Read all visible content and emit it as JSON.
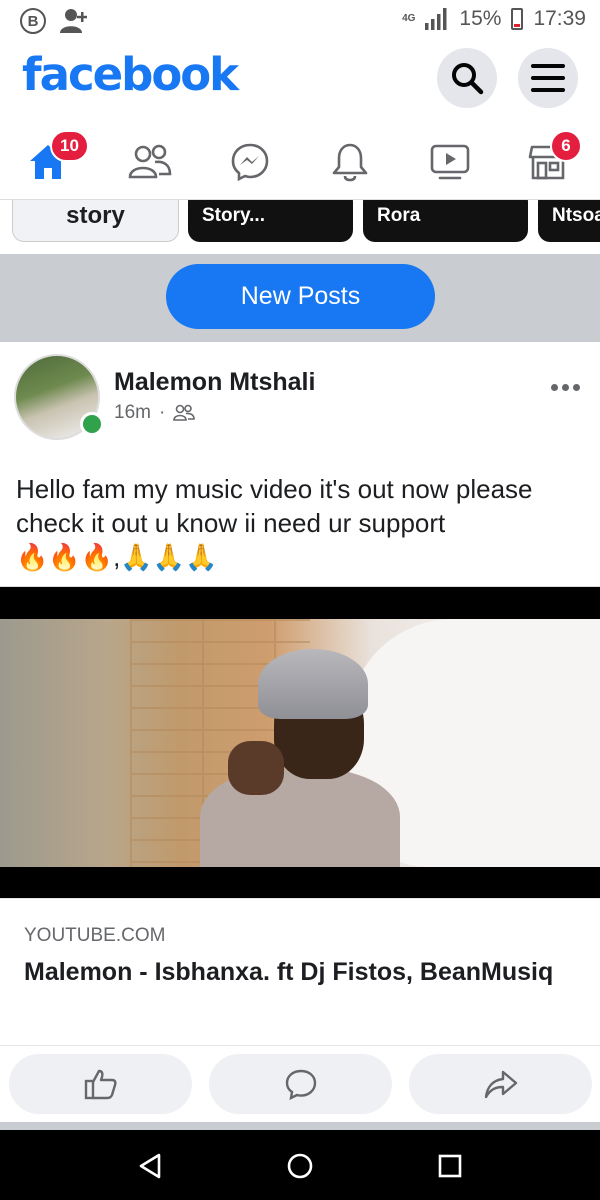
{
  "status_bar": {
    "network": "4G",
    "battery": "15%",
    "time": "17:39"
  },
  "header": {
    "logo": "facebook"
  },
  "nav": {
    "home_badge": "10",
    "marketplace_badge": "6"
  },
  "stories": [
    {
      "label": "story"
    },
    {
      "label": "Story..."
    },
    {
      "label": "Rora"
    },
    {
      "label": "Ntsoa"
    }
  ],
  "new_posts_label": "New Posts",
  "post": {
    "author": "Malemon Mtshali",
    "time": "16m",
    "separator": "·",
    "text_line1": "Hello fam my music video it's out now please",
    "text_line2": "check it out u know ii need ur support",
    "text_line3": "🔥🔥🔥,🙏🙏🙏",
    "link_domain": "YOUTUBE.COM",
    "link_title": "Malemon - Isbhanxa. ft Dj Fistos, BeanMusiq"
  },
  "icons": {
    "blackberry": "b-icon",
    "add_friend": "add-person-icon",
    "search": "search-icon",
    "menu": "menu-icon",
    "home": "home-icon",
    "friends": "friends-icon",
    "messenger": "messenger-icon",
    "notifications": "bell-icon",
    "watch": "video-icon",
    "marketplace": "store-icon"
  },
  "colors": {
    "brand": "#1877f2",
    "badge": "#e41e3f",
    "online": "#31a24c"
  }
}
